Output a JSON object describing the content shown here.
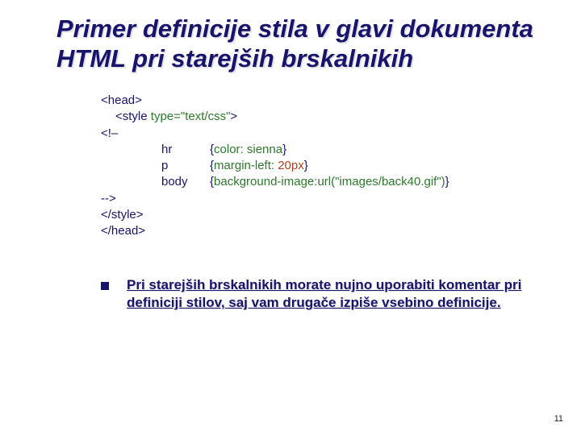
{
  "title": "Primer definicije stila v glavi dokumenta HTML pri starejših brskalnikih",
  "code": {
    "head_open": "<head>",
    "style_open_pre": "<style ",
    "style_open_attr": "type=\"text/css\"",
    "style_open_post": ">",
    "comment_open": "<!–",
    "rules": [
      {
        "selector": "hr",
        "pre": "{",
        "prop": "color:",
        "val": " sienna",
        "post": "}"
      },
      {
        "selector": "p",
        "pre": "{",
        "prop": "margin-left:",
        "val": " 20px",
        "post": "}"
      },
      {
        "selector": "body",
        "pre": "{",
        "prop": "background-image:",
        "val": "url(\"images/back40.gif\")",
        "post": "}"
      }
    ],
    "comment_close": "-->",
    "style_close": "</style>",
    "head_close": "</head>"
  },
  "note": "Pri starejših brskalnikih morate nujno uporabiti komentar pri definiciji stilov, saj vam drugače izpiše vsebino definicije.",
  "page_number": "11"
}
